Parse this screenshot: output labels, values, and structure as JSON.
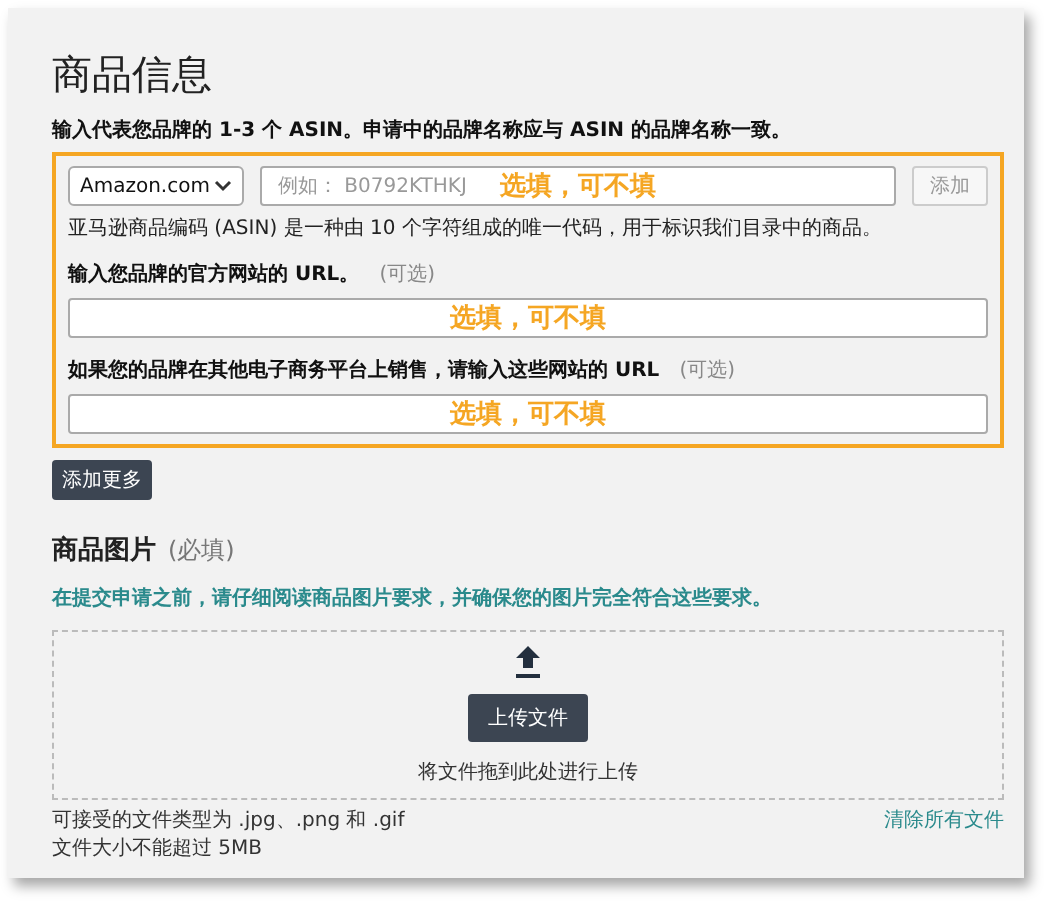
{
  "title": "商品信息",
  "asin_instruction": "输入代表您品牌的 1-3 个 ASIN。申请中的品牌名称应与 ASIN 的品牌名称一致。",
  "asin_row": {
    "marketplace": "Amazon.com",
    "placeholder": "例如： B0792KTHKJ",
    "annotation": "选填，可不填",
    "add_button": "添加",
    "help": "亚马逊商品编码 (ASIN) 是一种由 10 个字符组成的唯一代码，用于标识我们目录中的商品。"
  },
  "url_fields": [
    {
      "label": "输入您品牌的官方网站的 URL。",
      "optional": "(可选)",
      "annotation": "选填，可不填"
    },
    {
      "label": "如果您的品牌在其他电子商务平台上销售，请输入这些网站的 URL",
      "optional": "(可选)",
      "annotation": "选填，可不填"
    }
  ],
  "add_more_button": "添加更多",
  "images": {
    "title": "商品图片",
    "required": "(必填)",
    "instruction": "在提交申请之前，请仔细阅读商品图片要求，并确保您的图片完全符合这些要求。",
    "upload_button": "上传文件",
    "drop_hint": "将文件拖到此处进行上传",
    "accepted_types": "可接受的文件类型为 .jpg、.png 和 .gif",
    "size_limit": "文件大小不能超过 5MB",
    "clear_all": "清除所有文件"
  }
}
